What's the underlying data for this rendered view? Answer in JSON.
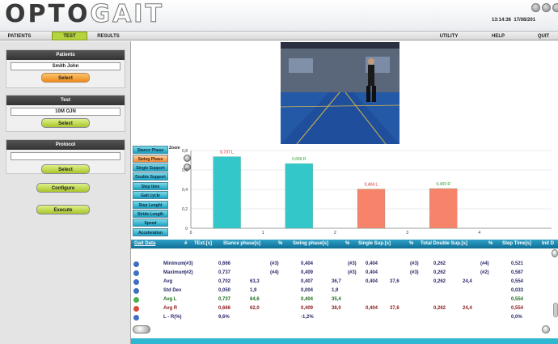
{
  "app": {
    "logo_a": "OPTO",
    "logo_b": "GAIT",
    "time": "13:14:36",
    "date": "17/08/201"
  },
  "menu": {
    "patients": "PATIENTS",
    "test": "TEST",
    "results": "RESULTS",
    "utility": "UTILITY",
    "help": "HELP",
    "quit": "QUIT"
  },
  "patients": {
    "title": "Patients",
    "name": "Smith John",
    "select": "Select"
  },
  "test": {
    "title": "Test",
    "name": "10M OJN",
    "select": "Select"
  },
  "protocol": {
    "title": "Protocol",
    "name": "",
    "select": "Select",
    "configure": "Configure",
    "execute": "Execute"
  },
  "tabs": [
    "Stance Phase",
    "Swing Phase",
    "Single Support",
    "Double Support",
    "Step time",
    "Gait cycle",
    "Step Lenght",
    "Stride Length",
    "Speed",
    "Acceleration"
  ],
  "zoom_label": "Zoom",
  "chart_data": {
    "type": "bar",
    "x": [
      1,
      2,
      3,
      4
    ],
    "values": [
      0.737,
      0.666,
      0.404,
      0.409
    ],
    "data_labels": [
      "0,737 L",
      "0,666 R",
      "0,404 L",
      "0,409 R"
    ],
    "colors": [
      "#33c7c9",
      "#33c7c9",
      "#f6836a",
      "#f6836a"
    ],
    "label_colors": [
      "#d02020",
      "#30a030",
      "#d02020",
      "#30a030"
    ],
    "y_ticks": [
      "0",
      "0,2",
      "0,4",
      "0,6",
      "0,8"
    ],
    "x_ticks": [
      "0",
      "1",
      "2",
      "3",
      "4"
    ],
    "ylim": [
      0,
      0.8
    ],
    "xlim": [
      0,
      5
    ],
    "grid": true
  },
  "table": {
    "headers": [
      "Gait Data",
      "#",
      "TExt.[s]",
      "Stance phase[s]",
      "%",
      "Swing phase[s]",
      "%",
      "Single Sup.[s]",
      "%",
      "Total Double Sup.[s]",
      "%",
      "Step Time[s]",
      "Init D"
    ],
    "rows": [
      {
        "label": "Minimum",
        "cells": [
          "(#3)",
          "0,666",
          "",
          "(#3)",
          "0,404",
          "",
          "(#3)",
          "0,404",
          "",
          "(#3)",
          "0,262",
          "",
          "(#4)",
          "0,521"
        ],
        "color": "#3f6fc0",
        "text": "#2a2a6a"
      },
      {
        "label": "Maximum",
        "cells": [
          "(#2)",
          "0,737",
          "",
          "(#4)",
          "0,409",
          "",
          "(#3)",
          "0,404",
          "",
          "(#3)",
          "0,262",
          "",
          "(#2)",
          "0,587"
        ],
        "color": "#3f6fc0",
        "text": "#2a2a6a"
      },
      {
        "label": "Avg",
        "cells": [
          "",
          "0,702",
          "63,3",
          "",
          "0,407",
          "36,7",
          "",
          "0,404",
          "37,6",
          "",
          "0,262",
          "24,4",
          "",
          "0,554"
        ],
        "color": "#3f6fc0",
        "text": "#2a2a6a"
      },
      {
        "label": "Std Dev",
        "cells": [
          "",
          "0,050",
          "1,9",
          "",
          "0,004",
          "1,9",
          "",
          "",
          "",
          "",
          "",
          "",
          "",
          "0,033"
        ],
        "color": "#3f6fc0",
        "text": "#2a2a6a"
      },
      {
        "label": "Avg L",
        "cells": [
          "",
          "0,737",
          "64,6",
          "",
          "0,404",
          "35,4",
          "",
          "",
          "",
          "",
          "",
          "",
          "",
          "0,554"
        ],
        "color": "#4caf50",
        "text": "#1f6b1f"
      },
      {
        "label": "Avg R",
        "cells": [
          "",
          "0,666",
          "62,0",
          "",
          "0,409",
          "38,0",
          "",
          "0,404",
          "37,6",
          "",
          "0,262",
          "24,4",
          "",
          "0,554"
        ],
        "color": "#d84a3a",
        "text": "#8a1a1a"
      },
      {
        "label": "L - R(%)",
        "cells": [
          "",
          "9,6%",
          "",
          "",
          "-1,2%",
          "",
          "",
          "",
          "",
          "",
          "",
          "",
          "",
          "0,0%"
        ],
        "color": "#3f6fc0",
        "text": "#2a2a6a"
      }
    ]
  }
}
